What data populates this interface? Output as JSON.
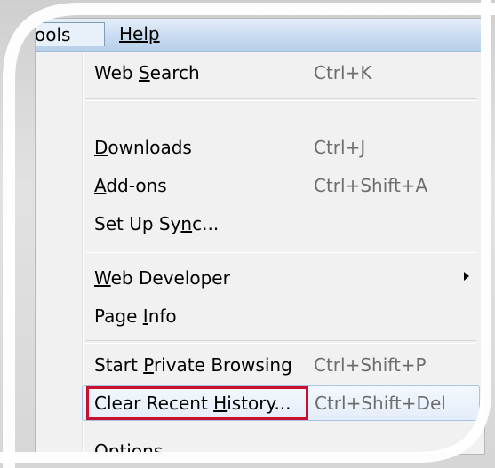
{
  "menubar": {
    "tools_label": "ools",
    "help_label": "Help"
  },
  "menu": {
    "items": [
      {
        "pre": "Web ",
        "ul": "S",
        "post": "earch",
        "shortcut": "Ctrl+K"
      },
      {
        "pre": "",
        "ul": "D",
        "post": "ownloads",
        "shortcut": "Ctrl+J"
      },
      {
        "pre": "",
        "ul": "A",
        "post": "dd-ons",
        "shortcut": "Ctrl+Shift+A"
      },
      {
        "pre": "Set Up Sy",
        "ul": "n",
        "post": "c...",
        "shortcut": ""
      },
      {
        "pre": "",
        "ul": "W",
        "post": "eb Developer",
        "shortcut": ""
      },
      {
        "pre": "Page ",
        "ul": "I",
        "post": "nfo",
        "shortcut": ""
      },
      {
        "pre": "Start ",
        "ul": "P",
        "post": "rivate Browsing",
        "shortcut": "Ctrl+Shift+P"
      },
      {
        "pre": "Clear Recent ",
        "ul": "H",
        "post": "istory...",
        "shortcut": "Ctrl+Shift+Del"
      },
      {
        "pre": "",
        "ul": "O",
        "post": "ptions",
        "shortcut": ""
      }
    ]
  },
  "colors": {
    "highlight_border": "#c8102e",
    "menubar_accent": "#b9d0ea"
  }
}
